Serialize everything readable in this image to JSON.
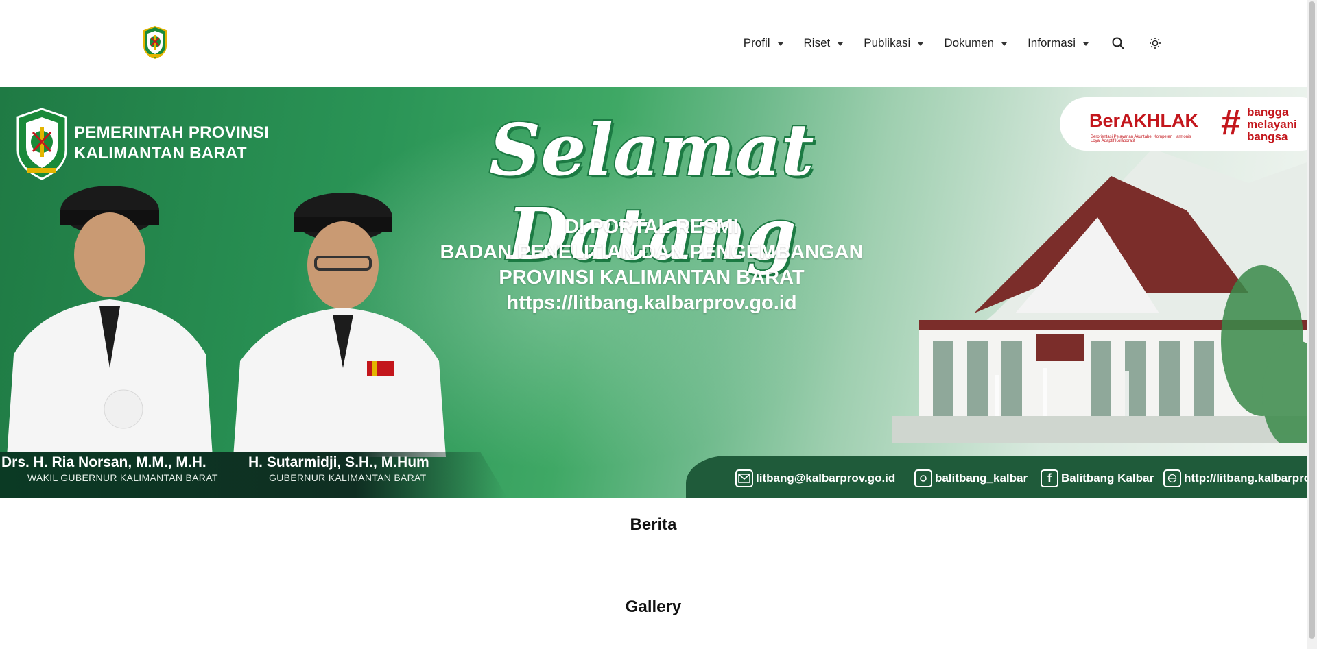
{
  "header": {
    "logo": "kalbar-emblem-icon",
    "nav": [
      {
        "label": "Profil"
      },
      {
        "label": "Riset"
      },
      {
        "label": "Publikasi"
      },
      {
        "label": "Dokumen"
      },
      {
        "label": "Informasi"
      }
    ],
    "search_icon": "search-icon",
    "theme_icon": "sun-icon"
  },
  "banner": {
    "gov_line1": "PEMERINTAH PROVINSI",
    "gov_line2": "KALIMANTAN BARAT",
    "welcome": "Selamat Datang",
    "line1": "DI PORTAL RESMI",
    "line2": "BADAN PENELITIAN DAN PENGEMBANGAN",
    "line3": "PROVINSI KALIMANTAN BARAT",
    "url": "https://litbang.kalbarprov.go.id",
    "berakhlak": "BerAKHLAK",
    "berakhlak_sub": "Berorientasi Pelayanan Akuntabel Kompeten Harmonis Loyal Adaptif Kolaboratif",
    "bangga_1": "bangga",
    "bangga_2": "melayani",
    "bangga_3": "bangsa",
    "official1_name": "Drs. H. Ria Norsan, M.M., M.H.",
    "official1_role": "WAKIL GUBERNUR KALIMANTAN BARAT",
    "official2_name": "H. Sutarmidji, S.H., M.Hum",
    "official2_role": "GUBERNUR KALIMANTAN BARAT",
    "contact_email": "litbang@kalbarprov.go.id",
    "contact_instagram": "balitbang_kalbar",
    "contact_facebook": "Balitbang Kalbar",
    "contact_web": "http://litbang.kalbarprov.go.id"
  },
  "sections": {
    "news": "Berita",
    "gallery": "Gallery"
  },
  "colors": {
    "brand_green": "#1f7a44",
    "accent_red": "#c3161c"
  }
}
